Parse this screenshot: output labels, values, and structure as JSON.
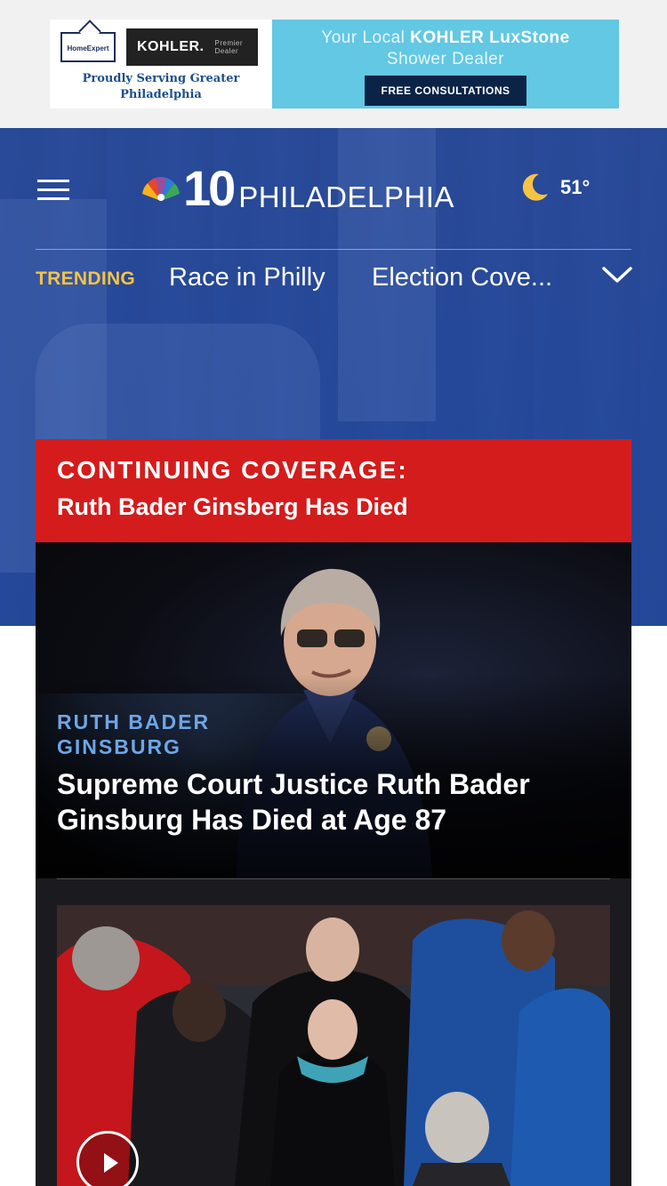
{
  "ad": {
    "logo_text": "HomeExpert",
    "brand": "KOHLER.",
    "brand_tag": "Premier Dealer",
    "serving": "Proudly Serving Greater Philadelphia",
    "headline_prefix": "Your Local",
    "headline_brand": "KOHLER LuxStone",
    "headline_suffix": "Shower Dealer",
    "cta": "FREE CONSULTATIONS"
  },
  "header": {
    "logo_number": "10",
    "logo_city": "PHILADELPHIA",
    "weather_icon": "moon-icon",
    "temperature": "51°"
  },
  "trending": {
    "label": "TRENDING",
    "items": [
      "Race in Philly",
      "Election Cove..."
    ]
  },
  "continuing_coverage": {
    "label": "CONTINUING COVERAGE:",
    "title": "Ruth Bader Ginsberg Has Died"
  },
  "stories": [
    {
      "category": "RUTH BADER GINSBURG",
      "headline": "Supreme Court Justice Ruth Bader Ginsburg Has Died at Age 87"
    },
    {
      "media_type": "video",
      "play_icon": "play-icon"
    }
  ],
  "colors": {
    "header_blue": "#2a4f96",
    "trending_gold": "#f6c343",
    "breaking_red": "#d41c1c",
    "category_blue": "#6ea6e6",
    "ad_cyan": "#62c8e3"
  }
}
